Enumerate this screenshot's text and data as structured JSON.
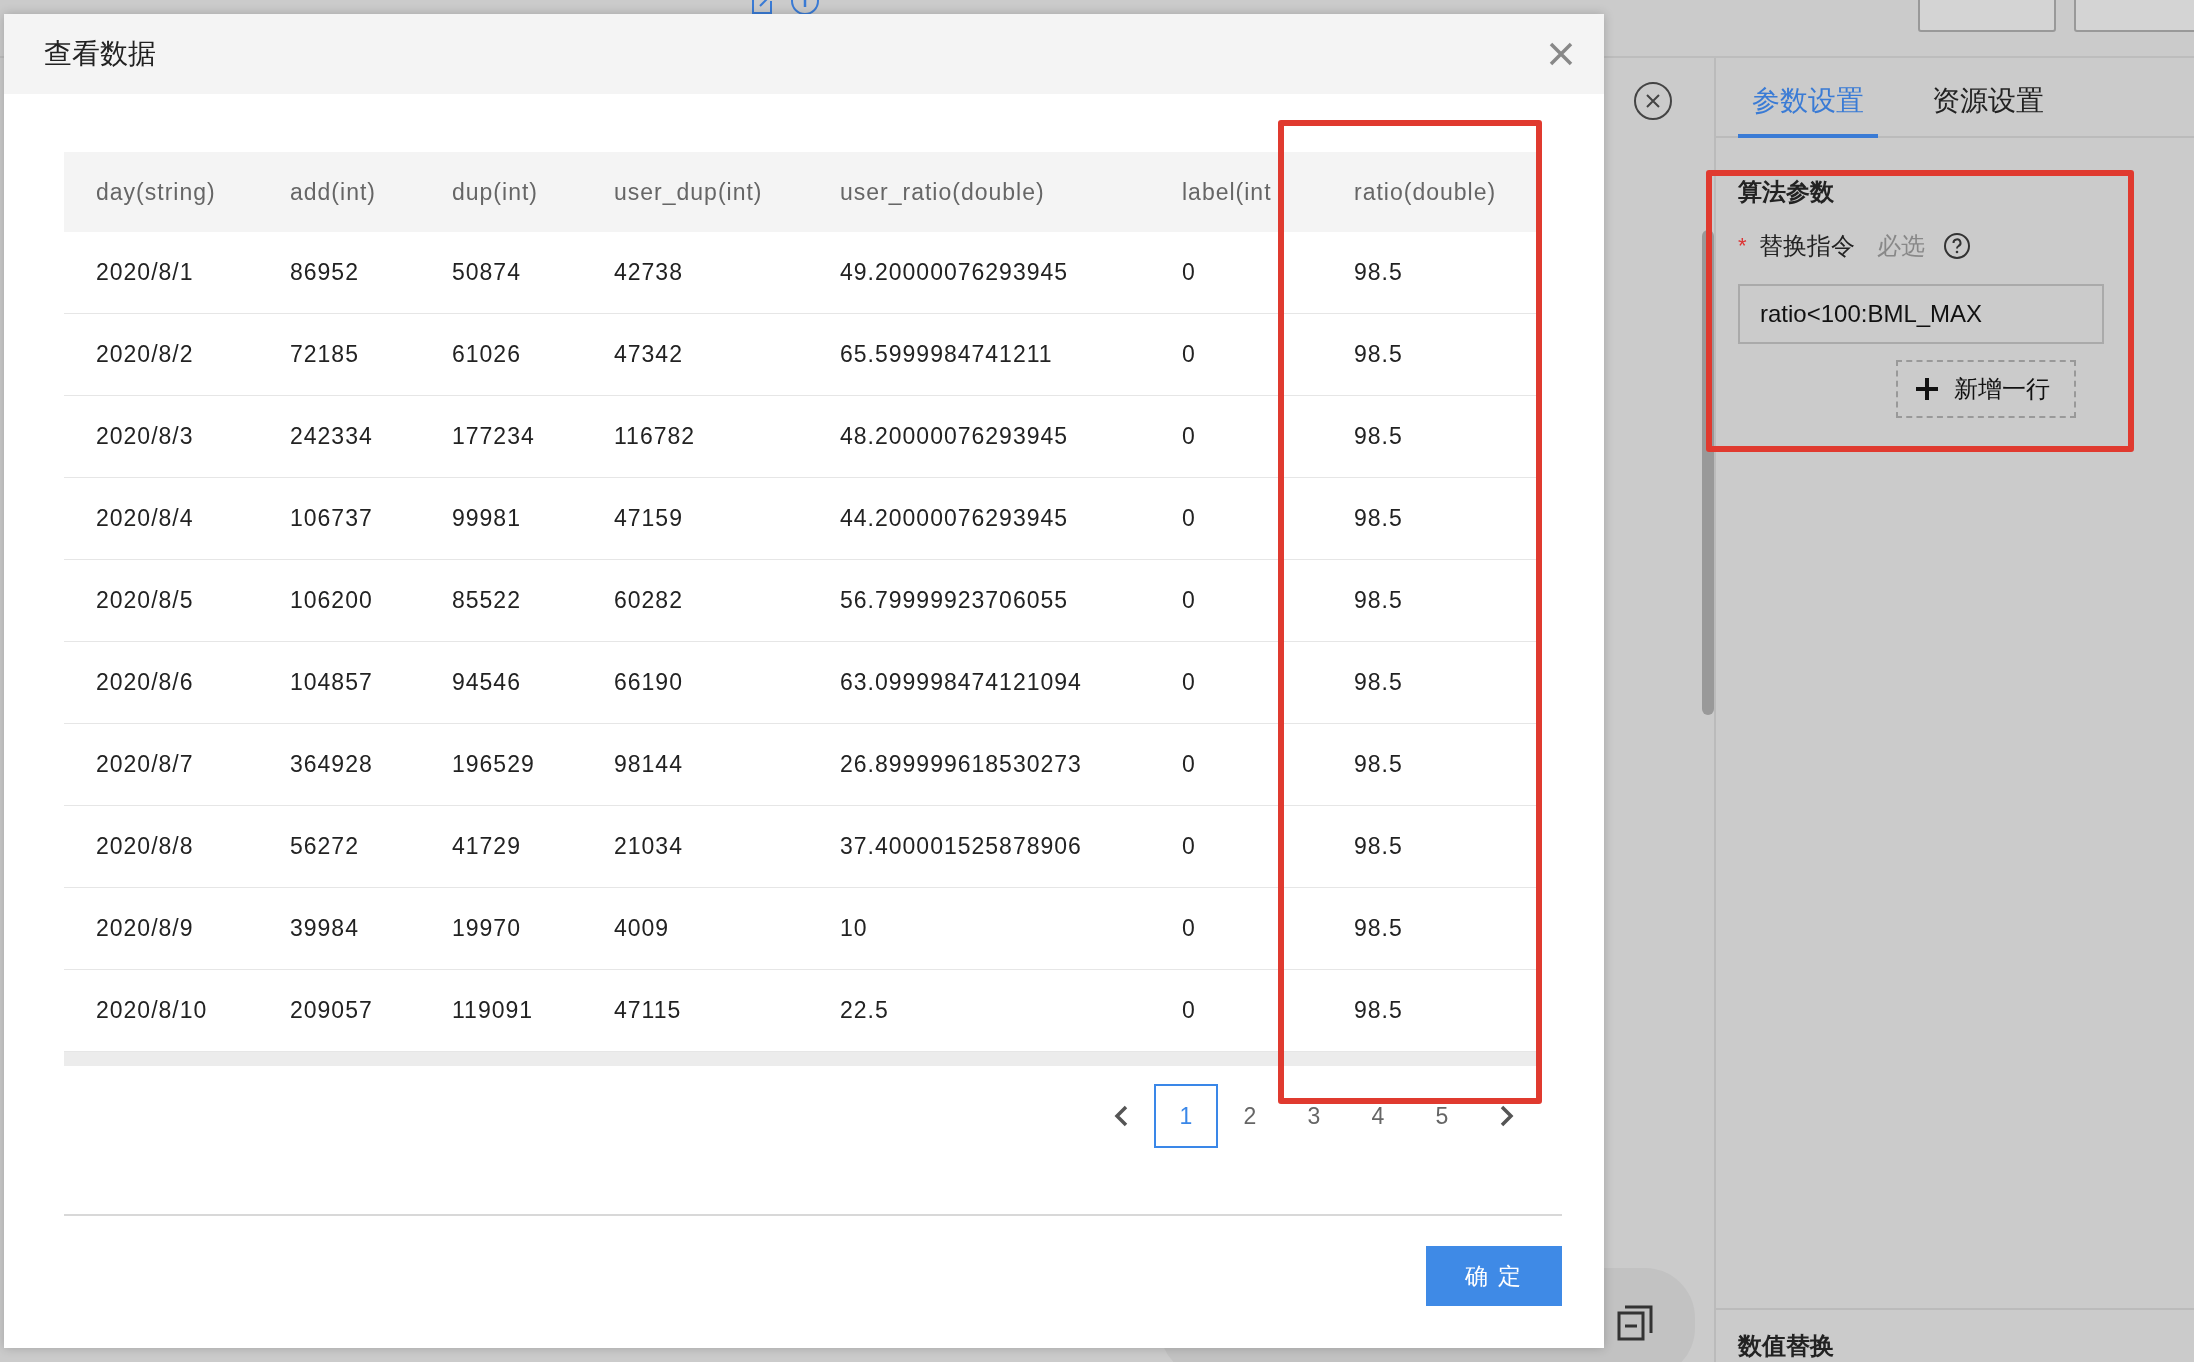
{
  "modal": {
    "title": "查看数据",
    "columns": [
      "day(string)",
      "add(int)",
      "dup(int)",
      "user_dup(int)",
      "user_ratio(double)",
      "label(int",
      "ratio(double)"
    ],
    "rows": [
      [
        "2020/8/1",
        "86952",
        "50874",
        "42738",
        "49.20000076293945",
        "0",
        "98.5"
      ],
      [
        "2020/8/2",
        "72185",
        "61026",
        "47342",
        "65.5999984741211",
        "0",
        "98.5"
      ],
      [
        "2020/8/3",
        "242334",
        "177234",
        "116782",
        "48.20000076293945",
        "0",
        "98.5"
      ],
      [
        "2020/8/4",
        "106737",
        "99981",
        "47159",
        "44.20000076293945",
        "0",
        "98.5"
      ],
      [
        "2020/8/5",
        "106200",
        "85522",
        "60282",
        "56.79999923706055",
        "0",
        "98.5"
      ],
      [
        "2020/8/6",
        "104857",
        "94546",
        "66190",
        "63.099998474121094",
        "0",
        "98.5"
      ],
      [
        "2020/8/7",
        "364928",
        "196529",
        "98144",
        "26.899999618530273",
        "0",
        "98.5"
      ],
      [
        "2020/8/8",
        "56272",
        "41729",
        "21034",
        "37.400001525878906",
        "0",
        "98.5"
      ],
      [
        "2020/8/9",
        "39984",
        "19970",
        "4009",
        "10",
        "0",
        "98.5"
      ],
      [
        "2020/8/10",
        "209057",
        "119091",
        "47115",
        "22.5",
        "0",
        "98.5"
      ]
    ],
    "pages": [
      {
        "label": "1",
        "selected": true
      },
      {
        "label": "2",
        "selected": false
      },
      {
        "label": "3",
        "selected": false
      },
      {
        "label": "4",
        "selected": false
      },
      {
        "label": "5",
        "selected": false
      }
    ],
    "confirm_button": "确 定"
  },
  "side_panel": {
    "tabs": [
      {
        "label": "参数设置",
        "selected": true
      },
      {
        "label": "资源设置",
        "selected": false
      }
    ],
    "section_title": "算法参数",
    "field": {
      "required_mark": "*",
      "label": "替换指令",
      "hint": "必选",
      "value": "ratio<100:BML_MAX"
    },
    "add_row_button": "新增一行",
    "next_section_title": "数值替换"
  }
}
